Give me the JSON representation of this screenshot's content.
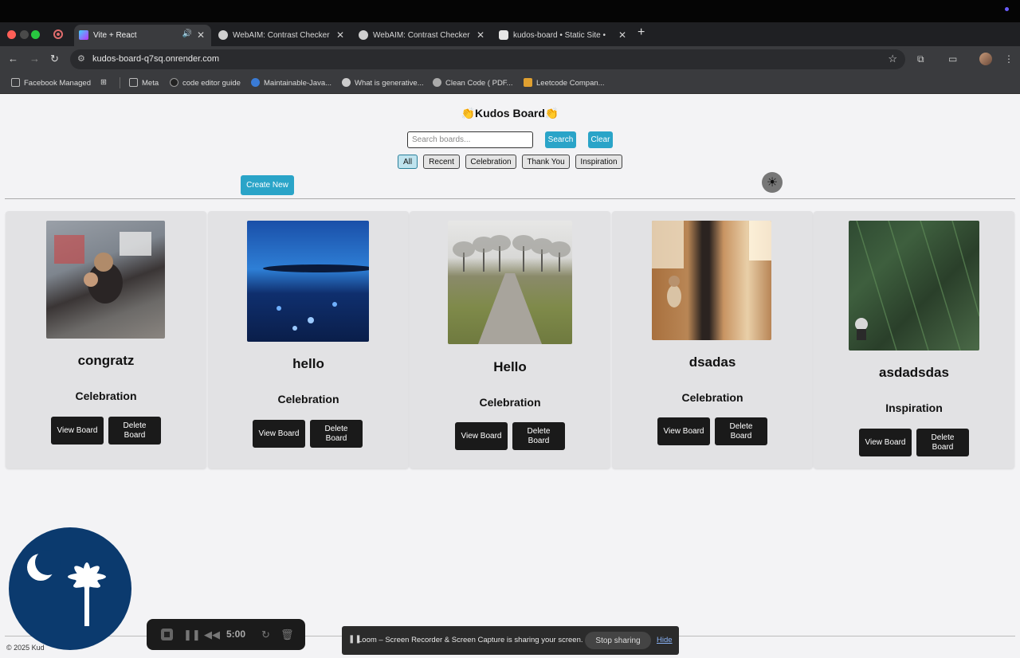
{
  "browser": {
    "tabs": [
      {
        "title": "Vite + React",
        "active": true
      },
      {
        "title": "WebAIM: Contrast Checker",
        "active": false
      },
      {
        "title": "WebAIM: Contrast Checker",
        "active": false
      },
      {
        "title": "kudos-board • Static Site •",
        "active": false
      }
    ],
    "url": "kudos-board-q7sq.onrender.com",
    "bookmarks": [
      "Facebook Managed",
      "Meta",
      "code editor guide",
      "Maintainable-Java...",
      "What is generative...",
      "Clean Code ( PDF...",
      "Leetcode Compan..."
    ]
  },
  "page": {
    "title": "👏Kudos Board👏",
    "search_placeholder": "Search boards...",
    "search_label": "Search",
    "clear_label": "Clear",
    "filters": [
      "All",
      "Recent",
      "Celebration",
      "Thank You",
      "Inspiration"
    ],
    "selected_filter": "All",
    "create_label": "Create New",
    "theme_icon": "sun-icon",
    "footer": "© 2025 Kud",
    "boards": [
      {
        "title": "congratz",
        "category": "Celebration",
        "view_label": "View Board",
        "delete_label": "Delete Board"
      },
      {
        "title": "hello",
        "category": "Celebration",
        "view_label": "View Board",
        "delete_label": "Delete Board"
      },
      {
        "title": "Hello",
        "category": "Celebration",
        "view_label": "View Board",
        "delete_label": "Delete Board"
      },
      {
        "title": "dsadas",
        "category": "Celebration",
        "view_label": "View Board",
        "delete_label": "Delete Board"
      },
      {
        "title": "asdadsdas",
        "category": "Inspiration",
        "view_label": "View Board",
        "delete_label": "Delete Board"
      }
    ]
  },
  "loom": {
    "timer": "5:00",
    "share_message": "Loom – Screen Recorder & Screen Capture is sharing your screen.",
    "stop_label": "Stop sharing",
    "hide_label": "Hide"
  },
  "colors": {
    "accent": "#2aa4c8",
    "dark_button": "#1a1a1a",
    "card_bg": "#e2e2e4"
  }
}
